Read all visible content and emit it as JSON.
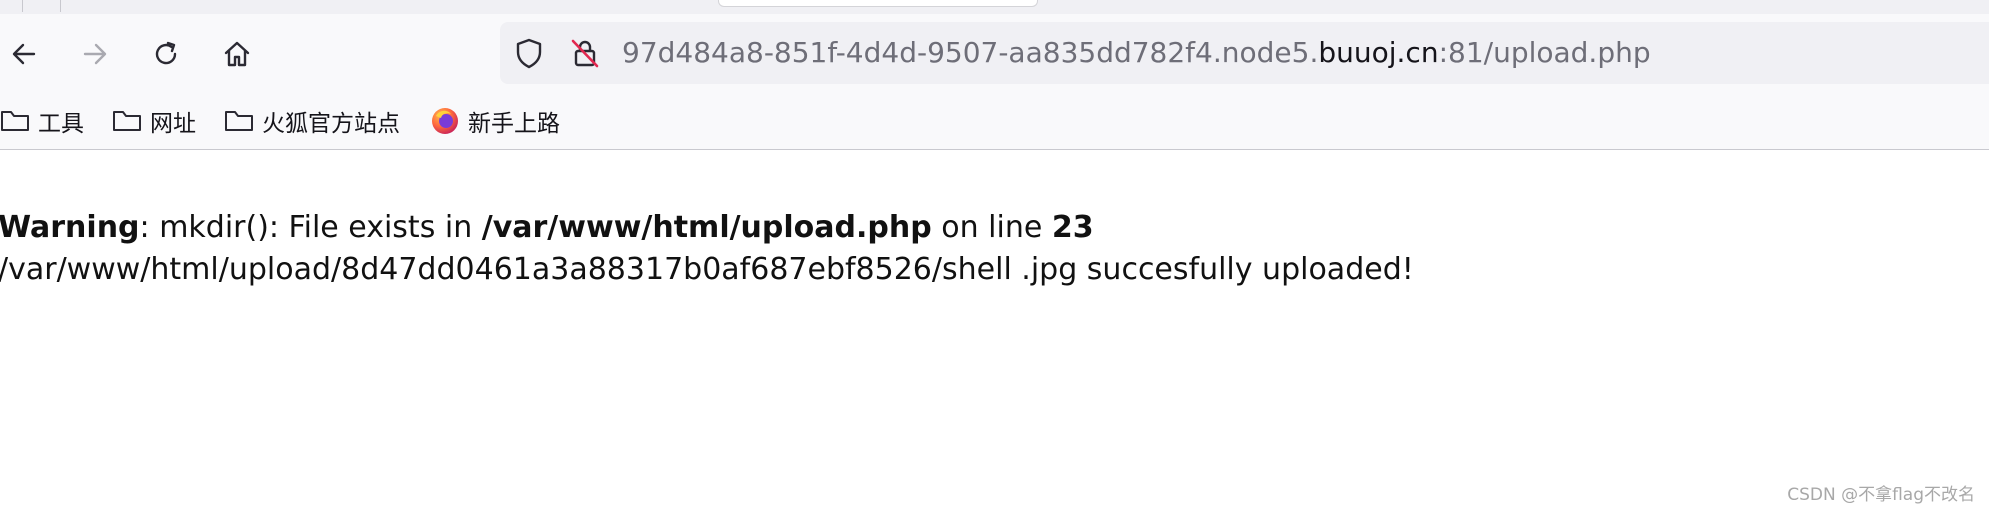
{
  "browser": {
    "nav": {
      "back_icon": "arrow-left-icon",
      "forward_icon": "arrow-right-icon",
      "reload_icon": "reload-icon",
      "home_icon": "home-icon"
    },
    "urlbar": {
      "prefix": "97d484a8-851f-4d4d-9507-aa835dd782f4.node5.",
      "host": "buuoj.cn",
      "suffix": ":81/upload.php",
      "shield_icon": "shield-icon",
      "insecure_icon": "insecure-lock-icon"
    },
    "bookmarks": [
      {
        "label": "工具",
        "icon": "folder-icon"
      },
      {
        "label": "网址",
        "icon": "folder-icon"
      },
      {
        "label": "火狐官方站点",
        "icon": "folder-icon"
      },
      {
        "label": "新手上路",
        "icon": "firefox-icon"
      }
    ]
  },
  "page": {
    "warning_label": "Warning",
    "warning_text": ": mkdir(): File exists in ",
    "warning_file": "/var/www/html/upload.php",
    "warning_on_line": " on line ",
    "warning_line": "23",
    "upload_message": "/var/www/html/upload/8d47dd0461a3a88317b0af687ebf8526/shell .jpg succesfully uploaded!"
  },
  "watermark": "CSDN @不拿flag不改名",
  "colors": {
    "toolbar_bg": "#f9f9fb",
    "urlbar_bg": "#f0f0f4",
    "url_dim": "#6e6e78",
    "url_host": "#15141a"
  }
}
